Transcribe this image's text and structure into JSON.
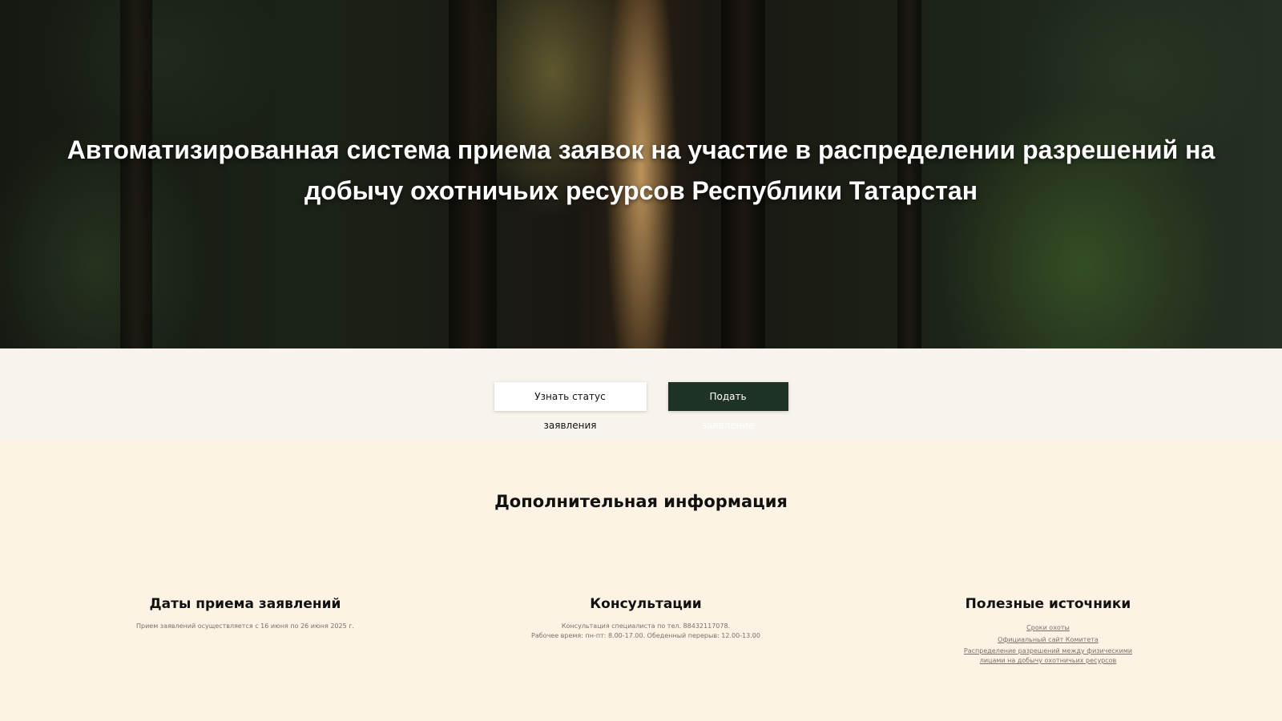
{
  "hero": {
    "title": "Автоматизированная система приема заявок на участие в распределении разрешений на добычу охотничьих ресурсов Республики Татарстан"
  },
  "actions": {
    "status_label": "Узнать статус заявления",
    "apply_label": "Подать заявление"
  },
  "info": {
    "heading": "Дополнительная информация",
    "dates": {
      "title": "Даты приема заявлений",
      "text": "Прием заявлений осуществляется с 16 июня по 26 июня 2025 г."
    },
    "consult": {
      "title": "Консультации",
      "line1": "Консультация специалиста по тел. 88432117078.",
      "line2": "Рабочее время: пн-пт: 8.00-17.00. Обеденный перерыв: 12.00-13.00"
    },
    "sources": {
      "title": "Полезные источники",
      "link1": "Сроки охоты",
      "link2": "Официальный сайт Комитета",
      "link3": "Распределение разрешений между физическими лицами на добычу охотничьих ресурсов"
    }
  }
}
